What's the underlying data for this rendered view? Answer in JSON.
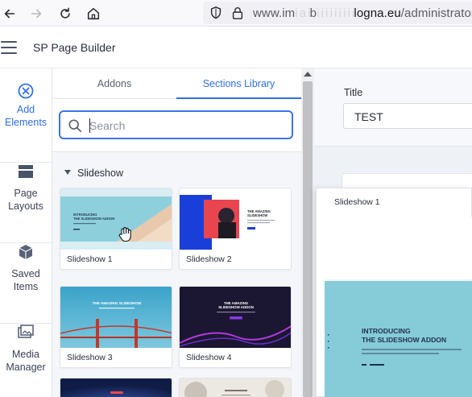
{
  "browser": {
    "url_prefix": "www.im",
    "url_host_1": "b",
    "url_host_2": "logna.eu",
    "url_path": "/administrator/i",
    "url_obscured_1": "i  a  i",
    "url_obscured_2": "i  i  i  i  i  i  i  i  i"
  },
  "app": {
    "title": "SP Page Builder"
  },
  "rail": {
    "items": [
      {
        "label_line1": "Add",
        "label_line2": "Elements",
        "icon": "plus-circle-icon"
      },
      {
        "label_line1": "Page",
        "label_line2": "Layouts",
        "icon": "layout-icon"
      },
      {
        "label_line1": "Saved",
        "label_line2": "Items",
        "icon": "cube-icon"
      },
      {
        "label_line1": "Media",
        "label_line2": "Manager",
        "icon": "media-icon"
      }
    ]
  },
  "panel": {
    "tabs": [
      "Addons",
      "Sections Library"
    ],
    "search_placeholder": "Search",
    "section_title": "Slideshow",
    "cards": [
      {
        "label": "Slideshow 1",
        "thumb_heading": "INTRODUCING\nTHE SLIDESHOW ADDON"
      },
      {
        "label": "Slideshow 2",
        "thumb_heading": "THE AMAZING\nSLIDESHOW"
      },
      {
        "label": "Slideshow 3",
        "thumb_heading": "THE AMAZING SLIDESHOW"
      },
      {
        "label": "Slideshow 4",
        "thumb_heading": "THE AMAZING\nSLIDESHOW ADDON"
      }
    ]
  },
  "editor": {
    "title_label": "Title",
    "title_value": "TEST"
  },
  "preview": {
    "title": "Slideshow 1",
    "heading_line1": "INTRODUCING",
    "heading_line2": "THE SLIDESHOW ADDON"
  },
  "colors": {
    "accent": "#2f6fea",
    "thumb_teal": "#7fc9d6",
    "thumb_blue": "#1a3fd8",
    "thumb_dark": "#1b1732"
  }
}
